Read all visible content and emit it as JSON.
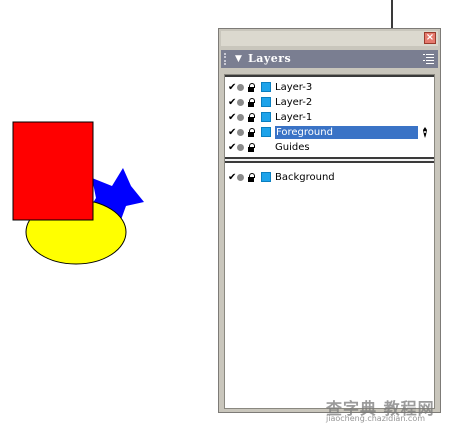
{
  "panel": {
    "title": "Layers",
    "close_symbol": "×",
    "collapse_icon": "triangle-down",
    "menu_icon": "options-menu-icon",
    "layers": [
      {
        "name": "Layer-3",
        "visible": true,
        "locked": false,
        "color": "#1ea3ea",
        "selected": false
      },
      {
        "name": "Layer-2",
        "visible": true,
        "locked": false,
        "color": "#1ea3ea",
        "selected": false
      },
      {
        "name": "Layer-1",
        "visible": true,
        "locked": false,
        "color": "#1ea3ea",
        "selected": false
      },
      {
        "name": "Foreground",
        "visible": true,
        "locked": false,
        "color": "#1ea3ea",
        "selected": true
      },
      {
        "name": "Guides",
        "visible": true,
        "locked": false,
        "color": null,
        "selected": false
      }
    ],
    "background_layers": [
      {
        "name": "Background",
        "visible": true,
        "locked": false,
        "color": "#1ea3ea",
        "selected": false
      }
    ]
  },
  "canvas": {
    "shapes": [
      {
        "type": "rectangle",
        "color": "#ff0000"
      },
      {
        "type": "ellipse",
        "color": "#ffff00"
      },
      {
        "type": "star",
        "color": "#0000ff"
      }
    ]
  },
  "watermark": {
    "main": "查字典 教程网",
    "sub": "jiaocheng.chazidian.com"
  },
  "colors": {
    "selection": "#3a73c6",
    "panel_header": "#7a7e91",
    "layer_swatch": "#1ea3ea"
  }
}
